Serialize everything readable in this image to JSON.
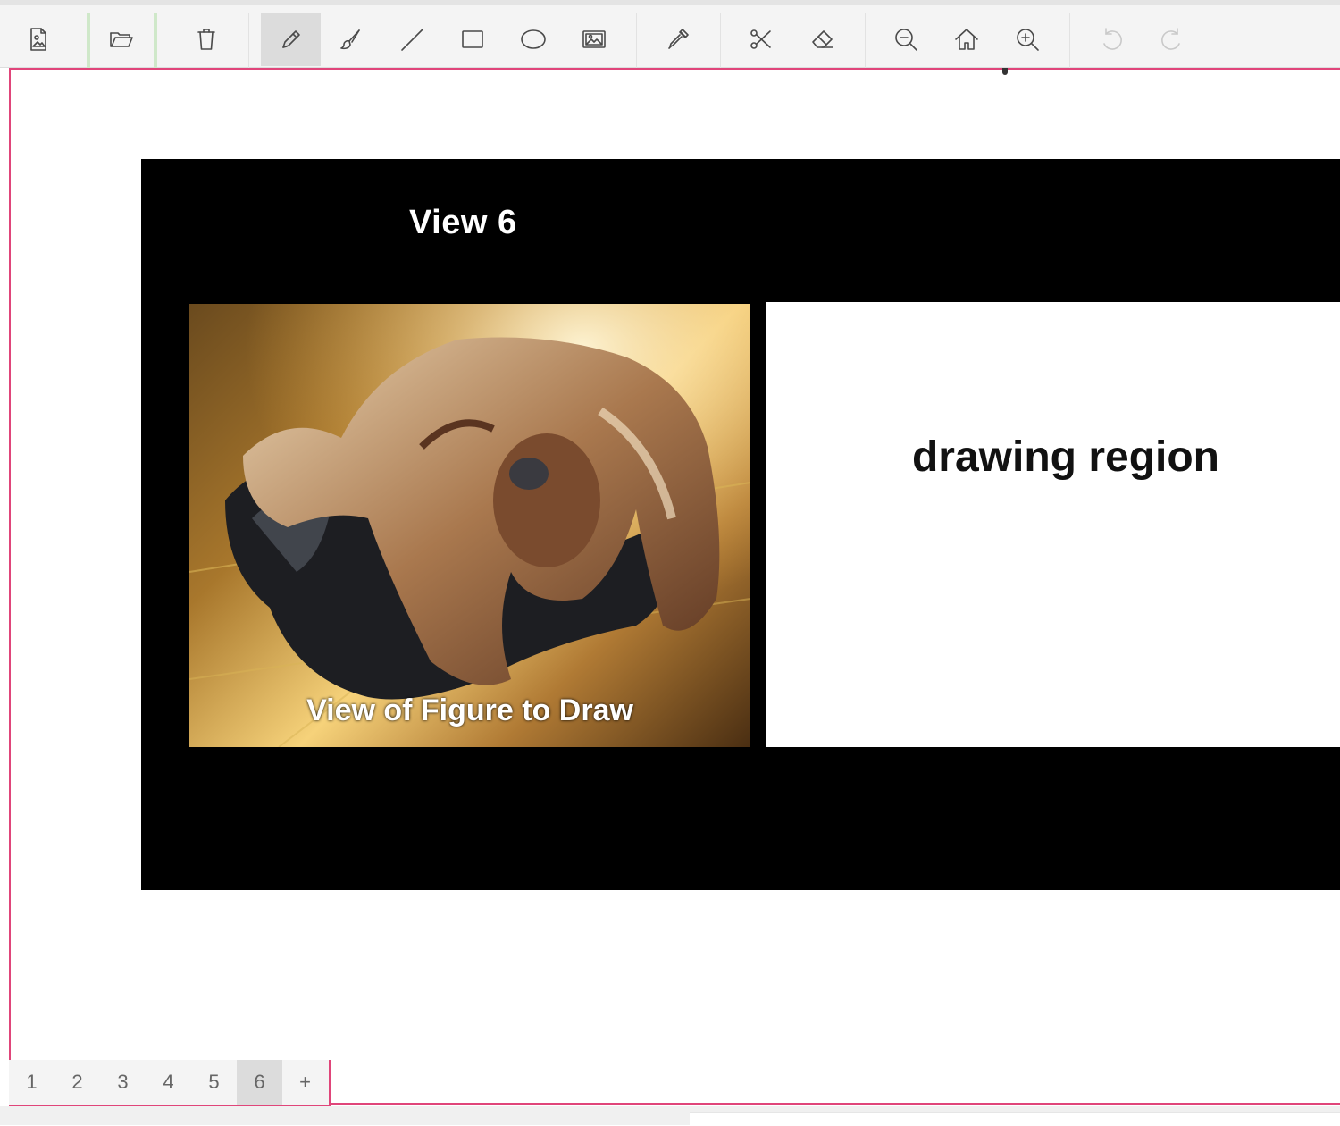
{
  "toolbar": {
    "tools": [
      {
        "id": "new-document",
        "icon": "document-image-icon"
      },
      {
        "id": "open",
        "icon": "folder-open-icon"
      },
      {
        "id": "delete",
        "icon": "trash-icon"
      },
      {
        "id": "pencil",
        "icon": "pencil-icon",
        "active": true
      },
      {
        "id": "brush",
        "icon": "brush-icon"
      },
      {
        "id": "line",
        "icon": "line-icon"
      },
      {
        "id": "rectangle",
        "icon": "rectangle-icon"
      },
      {
        "id": "ellipse",
        "icon": "ellipse-icon"
      },
      {
        "id": "image",
        "icon": "image-icon"
      },
      {
        "id": "eyedropper",
        "icon": "eyedropper-icon"
      },
      {
        "id": "cut",
        "icon": "scissors-icon"
      },
      {
        "id": "eraser",
        "icon": "eraser-icon"
      },
      {
        "id": "zoom-out",
        "icon": "zoom-out-icon"
      },
      {
        "id": "home",
        "icon": "home-icon"
      },
      {
        "id": "zoom-in",
        "icon": "zoom-in-icon"
      },
      {
        "id": "undo",
        "icon": "undo-icon",
        "disabled": true
      },
      {
        "id": "redo",
        "icon": "redo-icon",
        "disabled": true
      }
    ]
  },
  "slide": {
    "title": "View 6",
    "photo_caption": "View of Figure to Draw",
    "drawing_label": "drawing region"
  },
  "pages": {
    "tabs": [
      "1",
      "2",
      "3",
      "4",
      "5",
      "6"
    ],
    "active": "6",
    "add_label": "+"
  },
  "colors": {
    "accent": "#e0457a",
    "slide_bg": "#000000",
    "toolbar_bg": "#f4f4f4"
  }
}
